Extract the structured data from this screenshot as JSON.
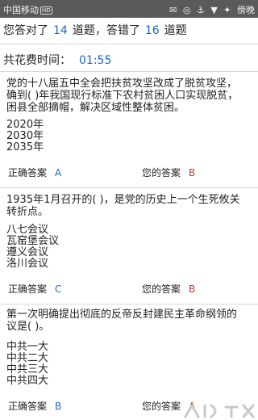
{
  "status_bar": {
    "carrier": "中国移动",
    "network_badge": "HD",
    "right_glyphs": [
      "✉",
      "◎",
      "⚓",
      "▼",
      "✦"
    ],
    "right_text": "傍晚"
  },
  "summary": {
    "prefix": "您答对了",
    "correct_count": "14",
    "middle": "道题，答错了",
    "wrong_count": "16",
    "suffix": "道题"
  },
  "time": {
    "label": "共花费时间：",
    "value": "01:55"
  },
  "questions": [
    {
      "lines": [
        "党的十八届五中全会把扶贫攻坚改成了脱贫攻坚，",
        "确到( )年我国现行标准下农村贫困人口实现脱贫，",
        "困县全部摘帽，解决区域性整体贫困。"
      ],
      "options": [
        "2020年",
        "2030年",
        "2035年"
      ],
      "correct_label": "正确答案",
      "correct_value": "A",
      "your_label": "您的答案",
      "your_value": "B"
    },
    {
      "lines": [
        "1935年1月召开的( )，是党的历史上一个生死攸关",
        "转折点。"
      ],
      "options": [
        "八七会议",
        "瓦窑堡会议",
        "遵义会议",
        "洛川会议"
      ],
      "correct_label": "正确答案",
      "correct_value": "C",
      "your_label": "您的答案",
      "your_value": "B"
    },
    {
      "lines": [
        "第一次明确提出彻底的反帝反封建民主革命纲领的",
        "议是( )。"
      ],
      "options": [
        "中共一大",
        "中共二大",
        "中共三大",
        "中共四大"
      ],
      "correct_label": "正确答案",
      "correct_value": "B",
      "your_label": "您的答案",
      "your_value": "A"
    }
  ]
}
